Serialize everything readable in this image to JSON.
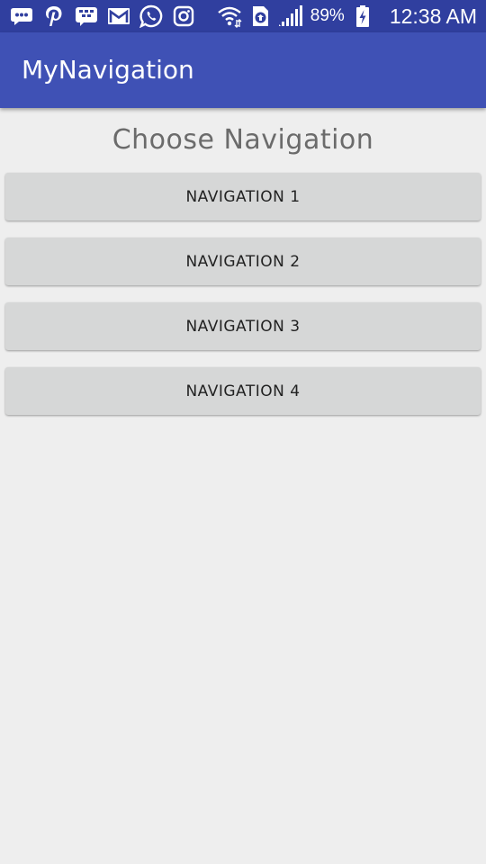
{
  "status_bar": {
    "battery_percent": "89%",
    "time": "12:38 AM",
    "left_icons": [
      "messages-icon",
      "pinterest-icon",
      "bbm-icon",
      "gmail-icon",
      "whatsapp-icon",
      "instagram-icon"
    ],
    "right_icons": [
      "wifi-icon",
      "sync-icon",
      "signal-icon",
      "battery-charging-icon"
    ]
  },
  "app_bar": {
    "title": "MyNavigation",
    "color": "#3f51b5"
  },
  "main": {
    "heading": "Choose Navigation",
    "buttons": [
      {
        "label": "NAVIGATION 1"
      },
      {
        "label": "NAVIGATION 2"
      },
      {
        "label": "NAVIGATION 3"
      },
      {
        "label": "NAVIGATION 4"
      }
    ]
  }
}
